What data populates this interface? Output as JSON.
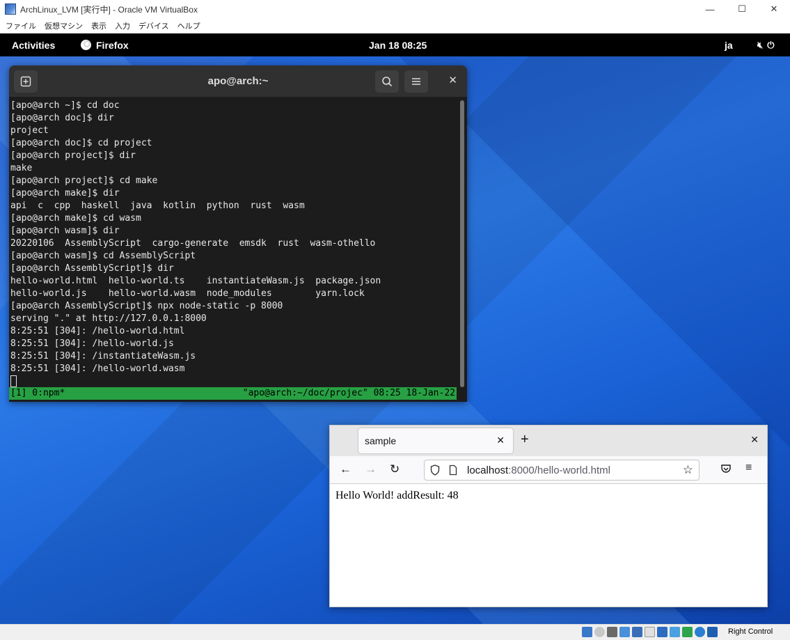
{
  "vbox": {
    "title": "ArchLinux_LVM [実行中] - Oracle VM VirtualBox",
    "menu": [
      "ファイル",
      "仮想マシン",
      "表示",
      "入力",
      "デバイス",
      "ヘルプ"
    ],
    "controls": {
      "minimize": "—",
      "maximize": "☐",
      "close": "✕"
    },
    "status_label": "Right Control"
  },
  "gnome": {
    "activities": "Activities",
    "app_name": "Firefox",
    "clock": "Jan 18  08:25",
    "ime": "ja",
    "icons": [
      "speaker-muted-icon",
      "power-icon"
    ]
  },
  "terminal": {
    "title": "apo@arch:~",
    "lines": [
      "[apo@arch ~]$ cd doc",
      "[apo@arch doc]$ dir",
      "project",
      "[apo@arch doc]$ cd project",
      "[apo@arch project]$ dir",
      "make",
      "[apo@arch project]$ cd make",
      "[apo@arch make]$ dir",
      "api  c  cpp  haskell  java  kotlin  python  rust  wasm",
      "[apo@arch make]$ cd wasm",
      "[apo@arch wasm]$ dir",
      "20220106  AssemblyScript  cargo-generate  emsdk  rust  wasm-othello",
      "[apo@arch wasm]$ cd AssemblyScript",
      "[apo@arch AssemblyScript]$ dir",
      "hello-world.html  hello-world.ts    instantiateWasm.js  package.json",
      "hello-world.js    hello-world.wasm  node_modules        yarn.lock",
      "[apo@arch AssemblyScript]$ npx node-static -p 8000",
      "serving \".\" at http://127.0.0.1:8000",
      "8:25:51 [304]: /hello-world.html",
      "8:25:51 [304]: /hello-world.js",
      "8:25:51 [304]: /instantiateWasm.js",
      "8:25:51 [304]: /hello-world.wasm"
    ],
    "tmux_left": "[1] 0:npm*",
    "tmux_right": "\"apo@arch:~/doc/projec\" 08:25 18-Jan-22"
  },
  "firefox": {
    "tab_title": "sample",
    "url_host": "localhost",
    "url_rest": ":8000/hello-world.html",
    "page_text": "Hello World! addResult: 48"
  }
}
